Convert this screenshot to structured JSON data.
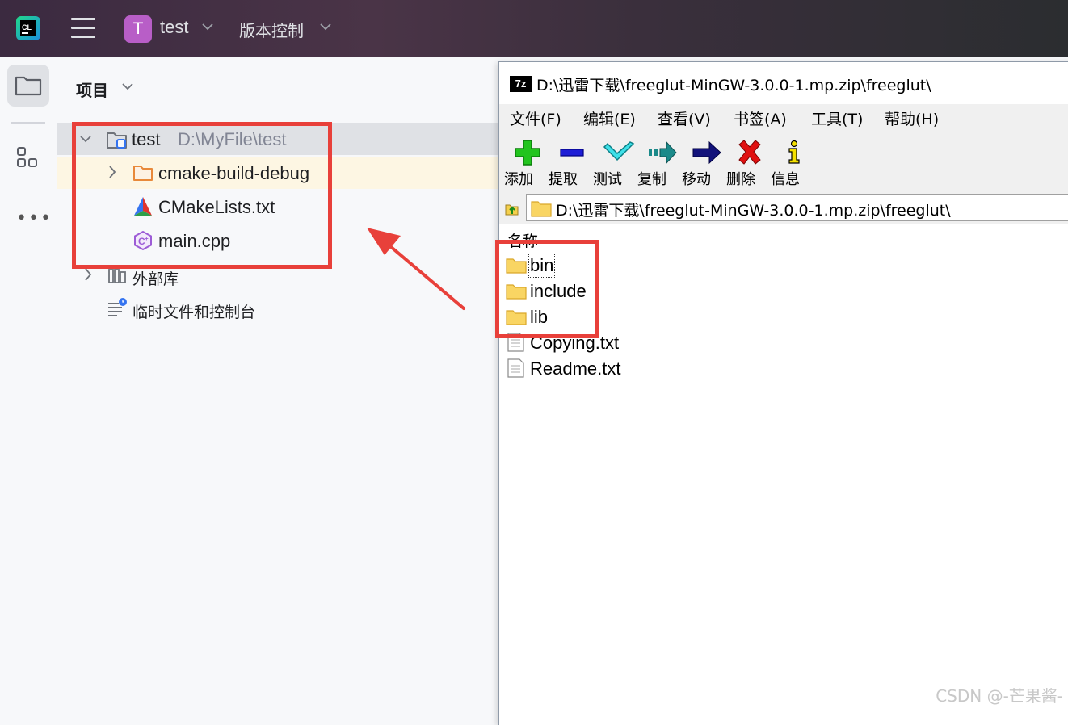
{
  "ide": {
    "logo_text": "CL",
    "project_initial": "T",
    "project_name": "test",
    "vcs_label": "版本控制",
    "panel_title": "项目",
    "tree": [
      {
        "label": "test",
        "path": "D:\\MyFile\\test"
      },
      {
        "label": "cmake-build-debug"
      },
      {
        "label": "CMakeLists.txt"
      },
      {
        "label": "main.cpp"
      },
      {
        "label": "外部库"
      },
      {
        "label": "临时文件和控制台"
      }
    ]
  },
  "zip": {
    "title_icon": "7z",
    "title": "D:\\迅雷下载\\freeglut-MinGW-3.0.0-1.mp.zip\\freeglut\\",
    "menu": [
      "文件(F)",
      "编辑(E)",
      "查看(V)",
      "书签(A)",
      "工具(T)",
      "帮助(H)"
    ],
    "toolbar": [
      {
        "label": "添加",
        "icon": "plus-icon"
      },
      {
        "label": "提取",
        "icon": "minus-icon"
      },
      {
        "label": "测试",
        "icon": "check-icon"
      },
      {
        "label": "复制",
        "icon": "copy-arrow-icon"
      },
      {
        "label": "移动",
        "icon": "move-arrow-icon"
      },
      {
        "label": "删除",
        "icon": "delete-x-icon"
      },
      {
        "label": "信息",
        "icon": "info-icon"
      }
    ],
    "address": "D:\\迅雷下载\\freeglut-MinGW-3.0.0-1.mp.zip\\freeglut\\",
    "column_name": "名称",
    "files": [
      {
        "name": "bin",
        "type": "folder"
      },
      {
        "name": "include",
        "type": "folder"
      },
      {
        "name": "lib",
        "type": "folder"
      },
      {
        "name": "Copying.txt",
        "type": "file"
      },
      {
        "name": "Readme.txt",
        "type": "file"
      }
    ]
  },
  "watermark": "CSDN @-芒果酱-",
  "colors": {
    "highlight_box": "#e8403a",
    "selection_row": "#dfe1e5",
    "hover_row": "#fdf6e3",
    "avatar": "#b85ec7"
  }
}
